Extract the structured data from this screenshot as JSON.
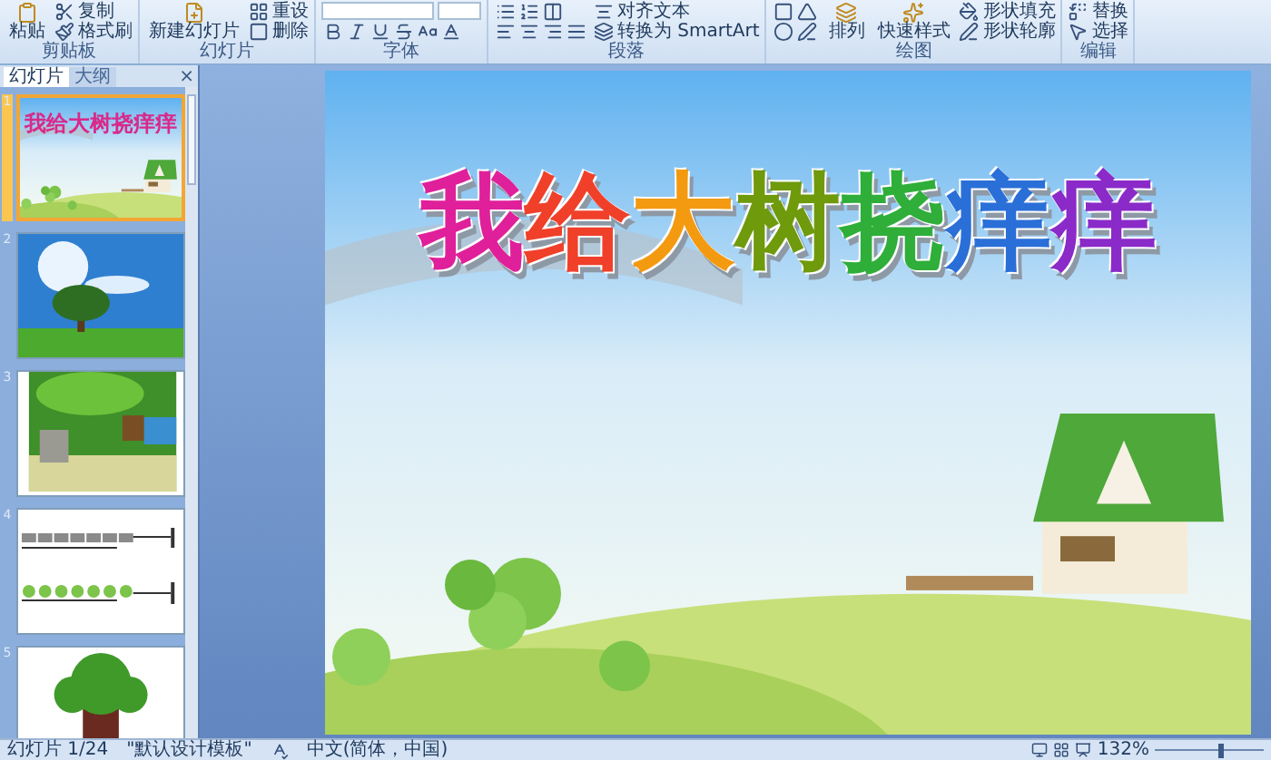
{
  "ribbon": {
    "groups": [
      {
        "kind": "clipboard",
        "label": "剪贴板",
        "big": "粘贴",
        "small": [
          "复制",
          "格式刷"
        ]
      },
      {
        "kind": "slides",
        "label": "幻灯片",
        "big": "新建幻灯片",
        "small": [
          "重设",
          "删除"
        ]
      },
      {
        "kind": "font",
        "label": "字体"
      },
      {
        "kind": "paragraph",
        "label": "段落",
        "small": [
          "对齐文本",
          "转换为 SmartArt"
        ]
      },
      {
        "kind": "drawing",
        "label": "绘图",
        "big": "排列",
        "mid": "快速样式",
        "small": [
          "形状填充",
          "形状轮廓"
        ]
      },
      {
        "kind": "editing",
        "label": "编辑",
        "small": [
          "替换",
          "选择"
        ]
      }
    ]
  },
  "panel": {
    "tabs": [
      {
        "label": "幻灯片",
        "selected": true
      },
      {
        "label": "大纲",
        "selected": false
      }
    ],
    "close": "×",
    "thumbnails": [
      {
        "number": "1",
        "kind": "title",
        "selected": true,
        "title": "我给大树挠痒痒"
      },
      {
        "number": "2",
        "kind": "sky",
        "selected": false
      },
      {
        "number": "3",
        "kind": "forest",
        "selected": false
      },
      {
        "number": "4",
        "kind": "rhythm",
        "selected": false
      },
      {
        "number": "5",
        "kind": "tree",
        "selected": false
      }
    ]
  },
  "slide": {
    "title": [
      {
        "char": "我",
        "color": "#e0209a"
      },
      {
        "char": "给",
        "color": "#f0402a"
      },
      {
        "char": "大",
        "color": "#f39a10"
      },
      {
        "char": "树",
        "color": "#6e9a0c"
      },
      {
        "char": "挠",
        "color": "#2fae3a"
      },
      {
        "char": "痒",
        "color": "#2a6fd8"
      },
      {
        "char": "痒",
        "color": "#8a2ac8"
      }
    ]
  },
  "status_bar": {
    "slide": "幻灯片 1/24",
    "theme": "\"默认设计模板\"",
    "language": "中文(简体，中国)",
    "zoom": "132%",
    "level": 0.6
  }
}
